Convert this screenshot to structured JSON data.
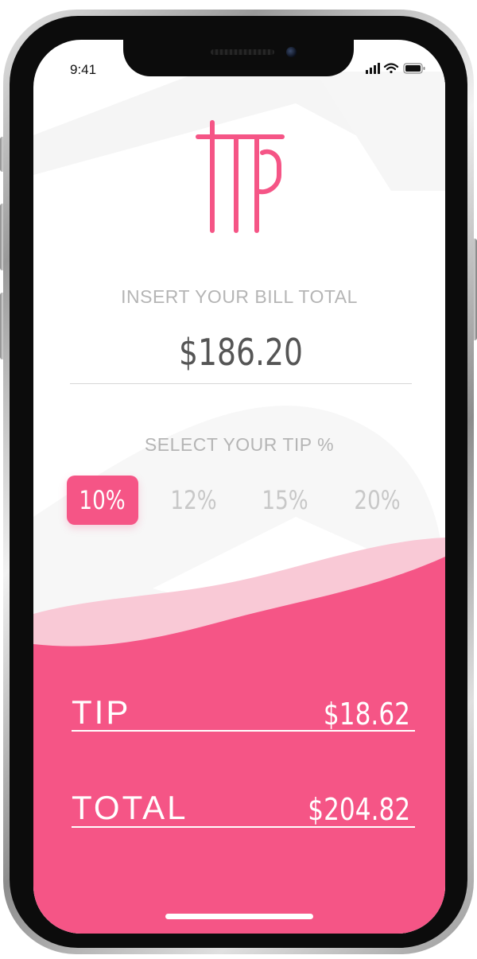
{
  "status_bar": {
    "time": "9:41",
    "icons": [
      "signal-icon",
      "wifi-icon",
      "battery-icon"
    ]
  },
  "app": {
    "logo_text": "tip",
    "accent_color": "#f55586",
    "light_accent_color": "#f9c9d6"
  },
  "bill": {
    "label": "INSERT YOUR BILL TOTAL",
    "value": "$186.20"
  },
  "tip_selector": {
    "label": "SELECT YOUR TIP %",
    "options": [
      "10%",
      "12%",
      "15%",
      "20%"
    ],
    "selected": "10%"
  },
  "results": {
    "tip_label": "TIP",
    "tip_value": "$18.62",
    "total_label": "TOTAL",
    "total_value": "$204.82"
  }
}
